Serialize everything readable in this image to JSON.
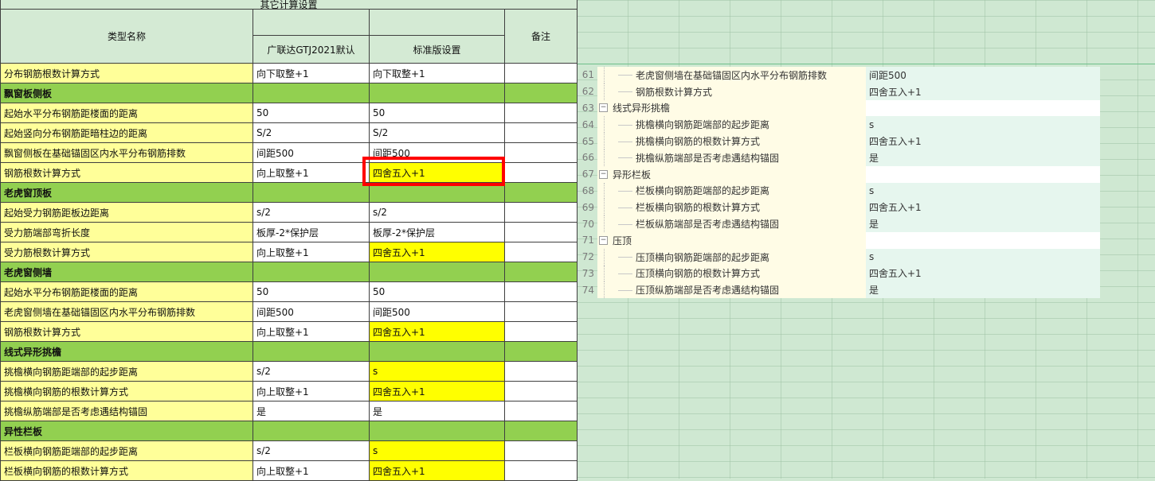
{
  "caption": "其它计算设置",
  "headers": {
    "type_name": "类型名称",
    "gtj_default": "广联达GTJ2021默认",
    "standard": "标准版设置",
    "note": "备注"
  },
  "rows": [
    {
      "name": "分布钢筋根数计算方式",
      "gtj": "向下取整+1",
      "std": "向下取整+1",
      "kind": "item",
      "hl": false
    },
    {
      "name": "飘窗板侧板",
      "gtj": "",
      "std": "",
      "kind": "section",
      "hl": false
    },
    {
      "name": "起始水平分布钢筋距楼面的距离",
      "gtj": "50",
      "std": "50",
      "kind": "item",
      "hl": false
    },
    {
      "name": "起始竖向分布钢筋距暗柱边的距离",
      "gtj": "S/2",
      "std": "S/2",
      "kind": "item",
      "hl": false
    },
    {
      "name": "飘窗侧板在基础锚固区内水平分布钢筋排数",
      "gtj": "间距500",
      "std": "间距500",
      "kind": "item",
      "hl": false
    },
    {
      "name": "钢筋根数计算方式",
      "gtj": "向上取整+1",
      "std": "四舍五入+1",
      "kind": "item",
      "hl": true
    },
    {
      "name": "老虎窗顶板",
      "gtj": "",
      "std": "",
      "kind": "section",
      "hl": false
    },
    {
      "name": "起始受力钢筋距板边距离",
      "gtj": "s/2",
      "std": "s/2",
      "kind": "item",
      "hl": false
    },
    {
      "name": "受力筋端部弯折长度",
      "gtj": "板厚-2*保护层",
      "std": "板厚-2*保护层",
      "kind": "item",
      "hl": false
    },
    {
      "name": "受力筋根数计算方式",
      "gtj": "向上取整+1",
      "std": "四舍五入+1",
      "kind": "item",
      "hl": true
    },
    {
      "name": "老虎窗侧墙",
      "gtj": "",
      "std": "",
      "kind": "section",
      "hl": false
    },
    {
      "name": "起始水平分布钢筋距楼面的距离",
      "gtj": "50",
      "std": "50",
      "kind": "item",
      "hl": false
    },
    {
      "name": "老虎窗侧墙在基础锚固区内水平分布钢筋排数",
      "gtj": "间距500",
      "std": "间距500",
      "kind": "item",
      "hl": false
    },
    {
      "name": "钢筋根数计算方式",
      "gtj": "向上取整+1",
      "std": "四舍五入+1",
      "kind": "item",
      "hl": true
    },
    {
      "name": "线式异形挑檐",
      "gtj": "",
      "std": "",
      "kind": "section",
      "hl": false
    },
    {
      "name": "挑檐横向钢筋距端部的起步距离",
      "gtj": "s/2",
      "std": "s",
      "kind": "item",
      "hl": true
    },
    {
      "name": "挑檐横向钢筋的根数计算方式",
      "gtj": "向上取整+1",
      "std": "四舍五入+1",
      "kind": "item",
      "hl": true
    },
    {
      "name": "挑檐纵筋端部是否考虑遇结构锚固",
      "gtj": "是",
      "std": "是",
      "kind": "item",
      "hl": false
    },
    {
      "name": "异性栏板",
      "gtj": "",
      "std": "",
      "kind": "section",
      "hl": false
    },
    {
      "name": "栏板横向钢筋距端部的起步距离",
      "gtj": "s/2",
      "std": "s",
      "kind": "item",
      "hl": true
    },
    {
      "name": "栏板横向钢筋的根数计算方式",
      "gtj": "向上取整+1",
      "std": "四舍五入+1",
      "kind": "item",
      "hl": true
    }
  ],
  "tree": [
    {
      "num": "61",
      "label": "老虎窗侧墙在基础锚固区内水平分布钢筋排数",
      "value": "间距500",
      "group": false
    },
    {
      "num": "62",
      "label": "钢筋根数计算方式",
      "value": "四舍五入+1",
      "group": false
    },
    {
      "num": "63",
      "label": "线式异形挑檐",
      "value": "",
      "group": true
    },
    {
      "num": "64",
      "label": "挑檐横向钢筋距端部的起步距离",
      "value": "s",
      "group": false
    },
    {
      "num": "65",
      "label": "挑檐横向钢筋的根数计算方式",
      "value": "四舍五入+1",
      "group": false
    },
    {
      "num": "66",
      "label": "挑檐纵筋端部是否考虑遇结构锚固",
      "value": "是",
      "group": false
    },
    {
      "num": "67",
      "label": "异形栏板",
      "value": "",
      "group": true
    },
    {
      "num": "68",
      "label": "栏板横向钢筋距端部的起步距离",
      "value": "s",
      "group": false
    },
    {
      "num": "69",
      "label": "栏板横向钢筋的根数计算方式",
      "value": "四舍五入+1",
      "group": false
    },
    {
      "num": "70",
      "label": "栏板纵筋端部是否考虑遇结构锚固",
      "value": "是",
      "group": false
    },
    {
      "num": "71",
      "label": "压顶",
      "value": "",
      "group": true
    },
    {
      "num": "72",
      "label": "压顶横向钢筋距端部的起步距离",
      "value": "s",
      "group": false
    },
    {
      "num": "73",
      "label": "压顶横向钢筋的根数计算方式",
      "value": "四舍五入+1",
      "group": false
    },
    {
      "num": "74",
      "label": "压顶纵筋端部是否考虑遇结构锚固",
      "value": "是",
      "group": false
    }
  ],
  "colors": {
    "name_bg": "#ffff99",
    "section_bg": "#92d050",
    "highlight_bg": "#ffff00",
    "header_bg": "#d4ead4",
    "selection_border": "#ff0000"
  }
}
